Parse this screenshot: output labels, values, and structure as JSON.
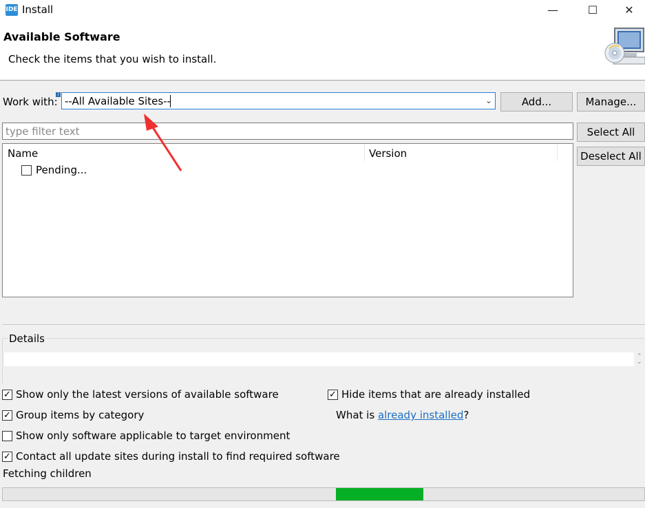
{
  "window": {
    "app_icon_text": "IDE",
    "title": "Install",
    "minimize": "—",
    "maximize": "☐",
    "close": "✕"
  },
  "header": {
    "title": "Available Software",
    "description": "Check the items that you wish to install.",
    "banner_icon": "install-cd-monitor-icon"
  },
  "work_with": {
    "label": "Work with:",
    "value": "--All Available Sites--",
    "info_icon": "i",
    "add_label": "Add...",
    "manage_label": "Manage..."
  },
  "filter": {
    "placeholder": "type filter text",
    "select_all_label": "Select All",
    "deselect_all_label": "Deselect All"
  },
  "tree": {
    "columns": [
      "Name",
      "Version"
    ],
    "rows": [
      {
        "name": "Pending...",
        "version": "",
        "checked": false
      }
    ]
  },
  "details": {
    "label": "Details",
    "text": ""
  },
  "options": {
    "show_latest": {
      "label": "Show only the latest versions of available software",
      "checked": true
    },
    "group_by_category": {
      "label": "Group items by category",
      "checked": true
    },
    "applicable_only": {
      "label": "Show only software applicable to target environment",
      "checked": false
    },
    "contact_all_sites": {
      "label": "Contact all update sites during install to find required software",
      "checked": true
    },
    "hide_installed": {
      "label": "Hide items that are already installed",
      "checked": true
    },
    "what_is_prefix": "What is ",
    "what_is_link": "already installed",
    "what_is_suffix": "?"
  },
  "status": {
    "text": "Fetching children",
    "progress_indeterminate": true
  },
  "colors": {
    "accent": "#2c7ad6",
    "progress": "#06b025",
    "link": "#1a6fc4",
    "annotation_arrow": "#f03030"
  }
}
